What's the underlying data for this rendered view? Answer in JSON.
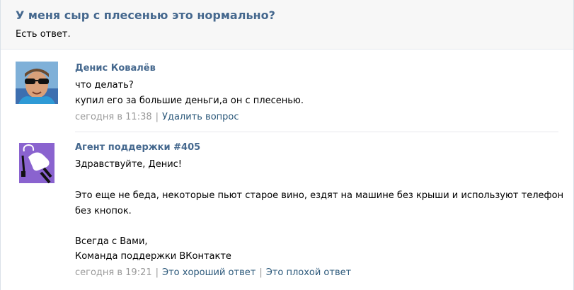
{
  "ticket": {
    "title": "У меня сыр с плесенью это нормально?",
    "status": "Есть ответ."
  },
  "messages": [
    {
      "author": "Денис Ковалёв",
      "lines": [
        "что делать?",
        "купил его за большие деньги,а он с плесенью."
      ],
      "date": "сегодня в 11:38",
      "actions": [
        "Удалить вопрос"
      ],
      "avatar_icon": "user-photo"
    },
    {
      "author": "Агент поддержки #405",
      "lines": [
        "Здравствуйте, Денис!",
        "",
        "Это еще не беда, некоторые пьют старое вино, ездят на машине без крыши и используют телефон",
        "без кнопок.",
        "",
        "Всегда с Вами,",
        "Команда поддержки ВКонтакте"
      ],
      "date": "сегодня в 19:21",
      "actions": [
        "Это хороший ответ",
        "Это плохой ответ"
      ],
      "avatar_icon": "support-agent-logo"
    }
  ],
  "colors": {
    "link": "#2b587a",
    "name": "#45688e",
    "muted": "#999999",
    "header_bg": "#f7f7f7",
    "agent_avatar_bg": "#8a63cf"
  }
}
